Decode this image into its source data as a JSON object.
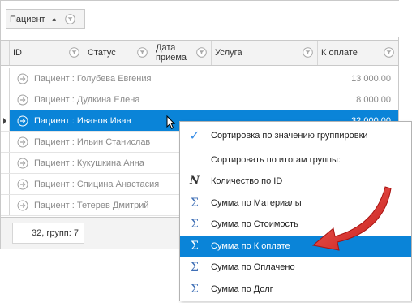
{
  "group_panel": {
    "chip_label": "Пациент"
  },
  "columns": [
    "ID",
    "Статус",
    "Дата",
    "приема",
    "Услуга",
    "К оплате"
  ],
  "rows": [
    {
      "label": "Пациент : Голубева Евгения",
      "value": "13 000.00"
    },
    {
      "label": "Пациент : Дудкина Елена",
      "value": "8 000.00"
    },
    {
      "label": "Пациент : Иванов Иван",
      "value": "32 000.00",
      "selected": true
    },
    {
      "label": "Пациент : Ильин Станислав",
      "value": ""
    },
    {
      "label": "Пациент : Кукушкина Анна",
      "value": ""
    },
    {
      "label": "Пациент : Спицина Анастасия",
      "value": ""
    },
    {
      "label": "Пациент : Тетерев Дмитрий",
      "value": ""
    }
  ],
  "footer": {
    "summary": "32, групп: 7"
  },
  "context_menu": {
    "items": [
      {
        "icon": "check-icon",
        "label": "Сортировка по значению группировки"
      },
      {
        "icon": "",
        "label": "Сортировать по итогам группы:"
      },
      {
        "icon": "count-icon",
        "icon_text": "N",
        "label": "Количество по ID"
      },
      {
        "icon": "sum-icon",
        "icon_text": "Σ",
        "label": "Сумма по Материалы"
      },
      {
        "icon": "sum-icon",
        "icon_text": "Σ",
        "label": "Сумма по Стоимость"
      },
      {
        "icon": "sum-icon",
        "icon_text": "Σ",
        "label": "Сумма по К оплате",
        "highlighted": true
      },
      {
        "icon": "sum-icon",
        "icon_text": "Σ",
        "label": "Сумма по Оплачено"
      },
      {
        "icon": "sum-icon",
        "icon_text": "Σ",
        "label": "Сумма по Долг"
      }
    ]
  },
  "colors": {
    "selection": "#0a84d8",
    "annotation_arrow": "#e0201f",
    "check": "#3a8ee6",
    "sigma": "#3f6fb6"
  }
}
